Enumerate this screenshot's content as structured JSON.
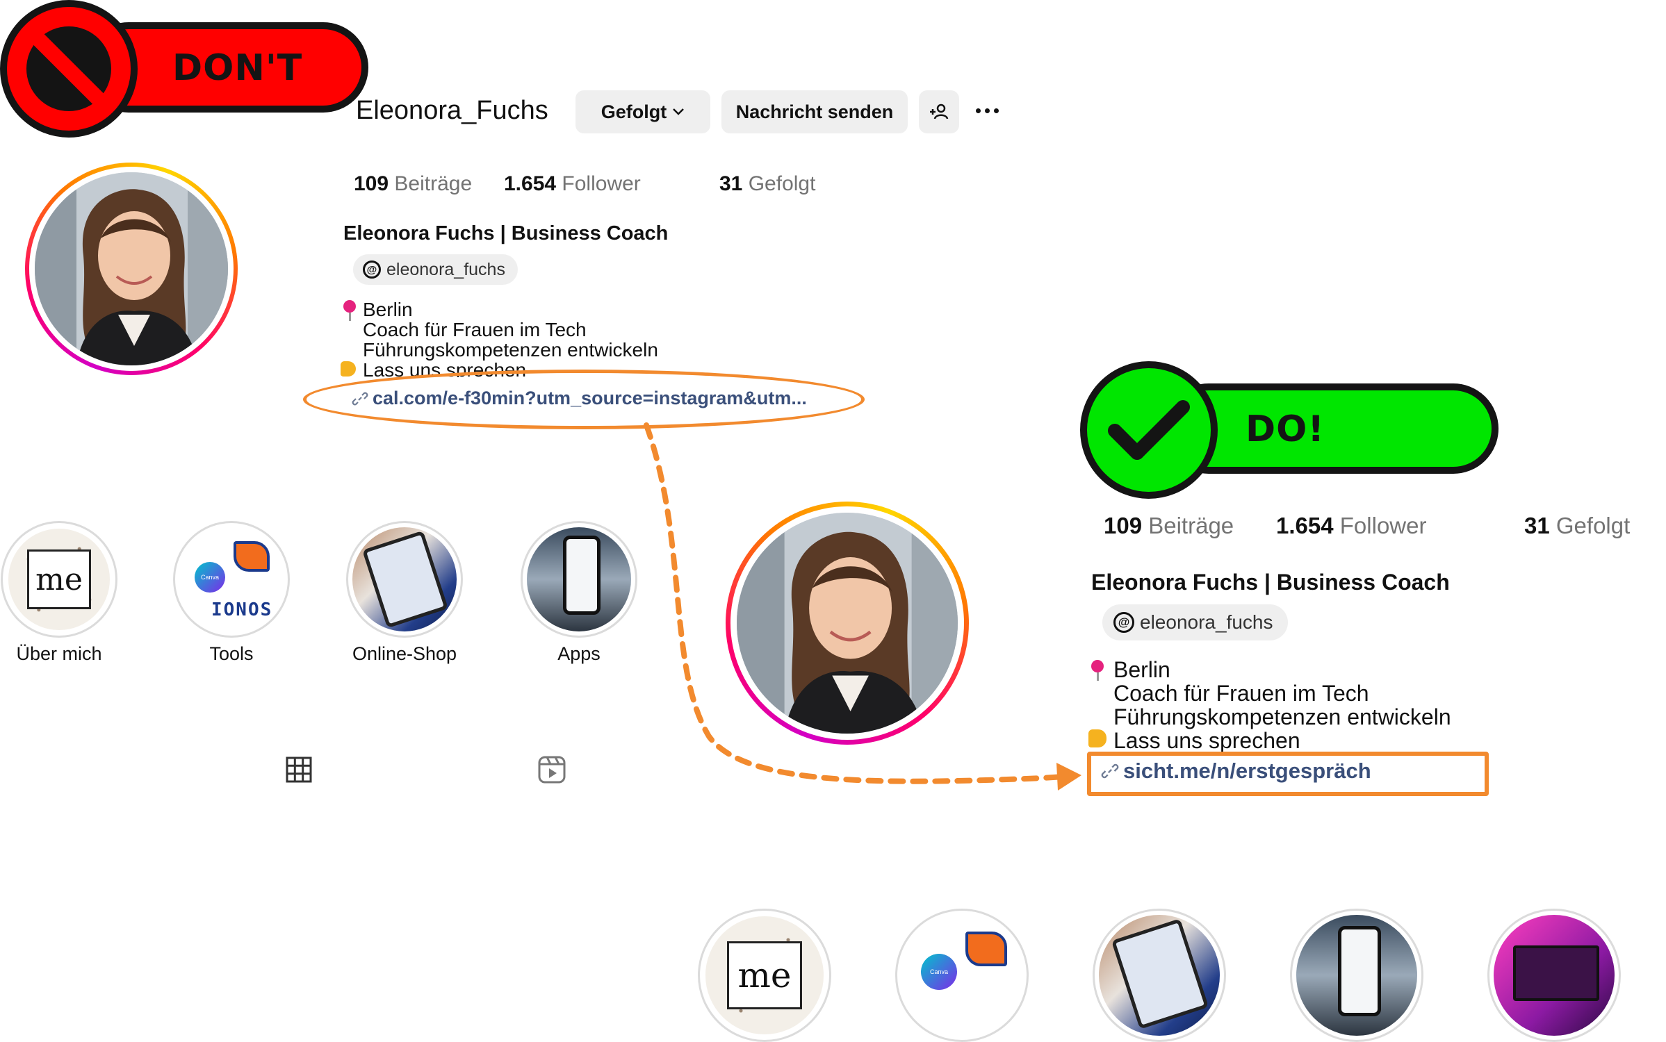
{
  "badges": {
    "dont": {
      "label": "DON'T",
      "color": "#ff0000",
      "icon": "prohibited-icon"
    },
    "do": {
      "label": "DO!",
      "color": "#00e600",
      "icon": "checkmark-icon"
    }
  },
  "accent": {
    "annotation_orange": "#f28a2e",
    "link_blue": "#3a4f7a"
  },
  "dont_profile": {
    "username": "Eleonora_Fuchs",
    "buttons": {
      "following": "Gefolgt",
      "message": "Nachricht senden",
      "add_user_icon": "add-user-icon",
      "more_icon": "more-icon"
    },
    "stats": [
      {
        "value": "109",
        "label": "Beiträge"
      },
      {
        "value": "1.654",
        "label": "Follower"
      },
      {
        "value": "31",
        "label": "Gefolgt"
      }
    ],
    "full_name": "Eleonora Fuchs | Business Coach",
    "threads_handle": "eleonora_fuchs",
    "bio": {
      "location": "Berlin",
      "line1": "Coach für Frauen im Tech",
      "line2": "Führungskompetenzen entwickeln",
      "line3": "Lass uns sprechen"
    },
    "link": "cal.com/e-f30min?utm_source=instagram&utm..."
  },
  "highlights": [
    {
      "label": "Über mich",
      "icon": "me-card"
    },
    {
      "label": "Tools",
      "icon": "canva-ionos"
    },
    {
      "label": "Online-Shop",
      "icon": "tablet-shop"
    },
    {
      "label": "Apps",
      "icon": "phone-app"
    }
  ],
  "tabs": {
    "grid_icon": "grid-icon",
    "reels_icon": "reels-icon"
  },
  "do_profile": {
    "stats": [
      {
        "value": "109",
        "label": "Beiträge"
      },
      {
        "value": "1.654",
        "label": "Follower"
      },
      {
        "value": "31",
        "label": "Gefolgt"
      }
    ],
    "full_name": "Eleonora Fuchs | Business Coach",
    "threads_handle": "eleonora_fuchs",
    "bio": {
      "location": "Berlin",
      "line1": "Coach für Frauen im Tech",
      "line2": "Führungskompetenzen entwickeln",
      "line3": "Lass uns sprechen"
    },
    "link": "sicht.me/n/erstgespräch"
  },
  "do_highlights_icons": [
    "me-card",
    "canva-ionos",
    "tablet-shop",
    "phone-app",
    "pink-screen"
  ]
}
